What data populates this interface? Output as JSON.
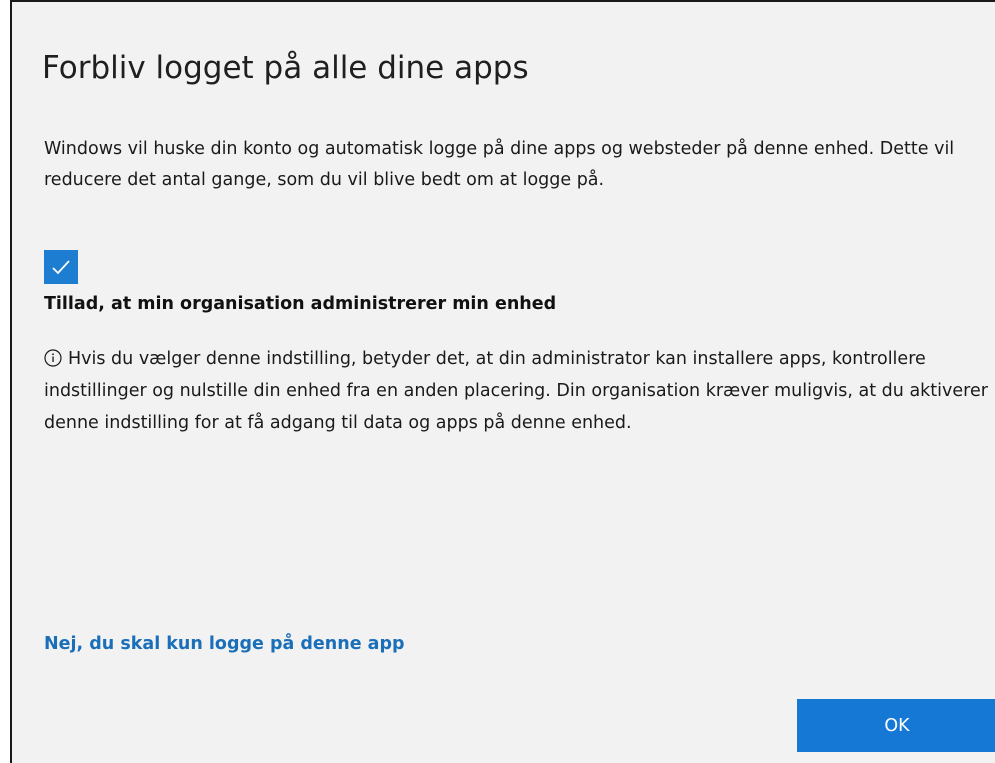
{
  "dialog": {
    "title": "Forbliv logget på alle dine apps",
    "description": "Windows vil huske din konto og automatisk logge på dine apps og websteder på denne enhed. Dette vil reducere det antal gange, som du vil blive bedt om at logge på.",
    "checkbox": {
      "checked": true,
      "label": "Tillad, at min organisation administrerer min enhed",
      "icon": "checkmark-icon"
    },
    "info": {
      "icon": "info-icon",
      "text": "Hvis du vælger denne indstilling, betyder det, at din administrator kan installere apps, kontrollere indstillinger og nulstille din enhed fra en anden placering. Din organisation kræver muligvis, at du aktiverer denne indstilling for at få adgang til data og apps på denne enhed."
    },
    "link_text": "Nej, du skal kun logge på denne app",
    "ok_label": "OK"
  },
  "colors": {
    "accent": "#1578d4",
    "link": "#1a6fb8",
    "background": "#f2f2f2"
  }
}
